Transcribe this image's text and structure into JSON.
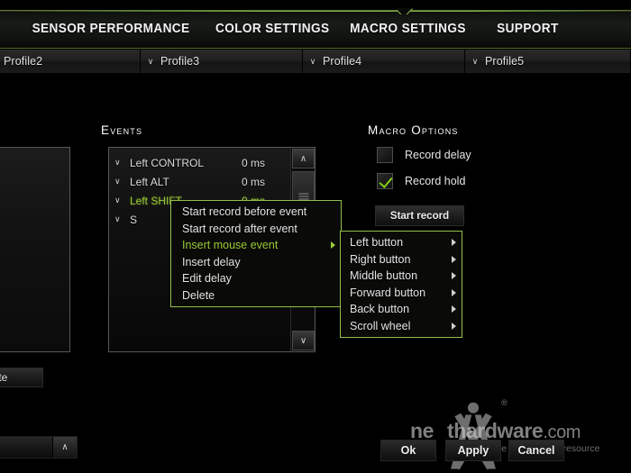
{
  "tabs": [
    {
      "id": "sensor-performance",
      "label": "SENSOR PERFORMANCE",
      "active": false
    },
    {
      "id": "color-settings",
      "label": "COLOR SETTINGS",
      "active": false
    },
    {
      "id": "macro-settings",
      "label": "MACRO SETTINGS",
      "active": true
    },
    {
      "id": "support",
      "label": "SUPPORT",
      "active": false
    }
  ],
  "profiles": [
    {
      "label": "Profile2",
      "chevron": ""
    },
    {
      "label": "Profile3",
      "chevron": "∨"
    },
    {
      "label": "Profile4",
      "chevron": "∨"
    },
    {
      "label": "Profile5",
      "chevron": "∨"
    }
  ],
  "events_section": {
    "heading": "Events",
    "rows": [
      {
        "chevron": "∨",
        "name": "Left CONTROL",
        "delay": "0 ms",
        "selected": false
      },
      {
        "chevron": "∨",
        "name": "Left ALT",
        "delay": "0 ms",
        "selected": false
      },
      {
        "chevron": "∨",
        "name": "Left SHIFT",
        "delay": "0 ms",
        "selected": true
      },
      {
        "chevron": "∨",
        "name": "S",
        "delay": "",
        "selected": false
      }
    ],
    "scroll_up": "∧",
    "scroll_down": "∨"
  },
  "macro_options": {
    "heading": "Macro Options",
    "record_delay": {
      "label": "Record delay",
      "checked": false
    },
    "record_hold": {
      "label": "Record hold",
      "checked": true
    },
    "start_record_label": "Start record"
  },
  "context_menu": {
    "items": [
      {
        "label": "Start record before event",
        "highlighted": false,
        "has_submenu": false
      },
      {
        "label": "Start record after event",
        "highlighted": false,
        "has_submenu": false
      },
      {
        "label": "Insert mouse event",
        "highlighted": true,
        "has_submenu": true
      },
      {
        "label": "Insert delay",
        "highlighted": false,
        "has_submenu": false
      },
      {
        "label": "Edit delay",
        "highlighted": false,
        "has_submenu": false
      },
      {
        "label": "Delete",
        "highlighted": false,
        "has_submenu": false
      }
    ]
  },
  "mouse_submenu": {
    "items": [
      {
        "label": "Left button",
        "has_submenu": true
      },
      {
        "label": "Right button",
        "has_submenu": true
      },
      {
        "label": "Middle button",
        "has_submenu": true
      },
      {
        "label": "Forward button",
        "has_submenu": true
      },
      {
        "label": "Back button",
        "has_submenu": true
      },
      {
        "label": "Scroll wheel",
        "has_submenu": true
      }
    ]
  },
  "left_panel": {
    "delete_button_label": "ete",
    "combo_chevron": "∧"
  },
  "footer": {
    "ok_label": "Ok",
    "apply_label": "Apply",
    "cancel_label": "Cancel"
  },
  "watermark": {
    "text_before": "ne",
    "text_after": "thardware",
    "dotcom": ".com",
    "tagline": "your ultimate professional resource"
  },
  "colors": {
    "accent_green": "#9ccc3a",
    "border_green": "#93bf4e",
    "check_green": "#86d019",
    "background": "#000000",
    "panel_border": "#585858",
    "text_primary": "#e6e6e6"
  }
}
